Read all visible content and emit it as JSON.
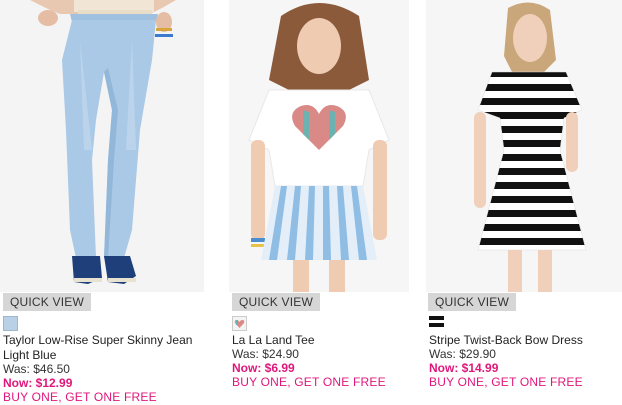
{
  "products": [
    {
      "quick_view": "QUICK VIEW",
      "name": "Taylor Low-Rise Super Skinny Jean",
      "color_name": "Light Blue",
      "was": "Was: $46.50",
      "now": "Now: $12.99",
      "promo": "BUY ONE, GET ONE FREE",
      "swatch_color": "#b9d0e6",
      "image_icon": "model-in-light-blue-skinny-jeans-image"
    },
    {
      "quick_view": "QUICK VIEW",
      "name": "La La Land Tee",
      "was": "Was: $24.90",
      "now": "Now: $6.99",
      "promo": "BUY ONE, GET ONE FREE",
      "swatch_color": "#e8b9c4",
      "image_icon": "model-in-heart-print-tee-and-striped-skirt-image"
    },
    {
      "quick_view": "QUICK VIEW",
      "name": "Stripe Twist-Back Bow Dress",
      "was": "Was: $29.90",
      "now": "Now: $14.99",
      "promo": "BUY ONE, GET ONE FREE",
      "swatch_color": "#111111",
      "image_icon": "model-in-black-white-stripe-dress-image"
    }
  ],
  "colors": {
    "accent_pink": "#e0177b",
    "quick_view_bg": "#d6d6d6"
  }
}
